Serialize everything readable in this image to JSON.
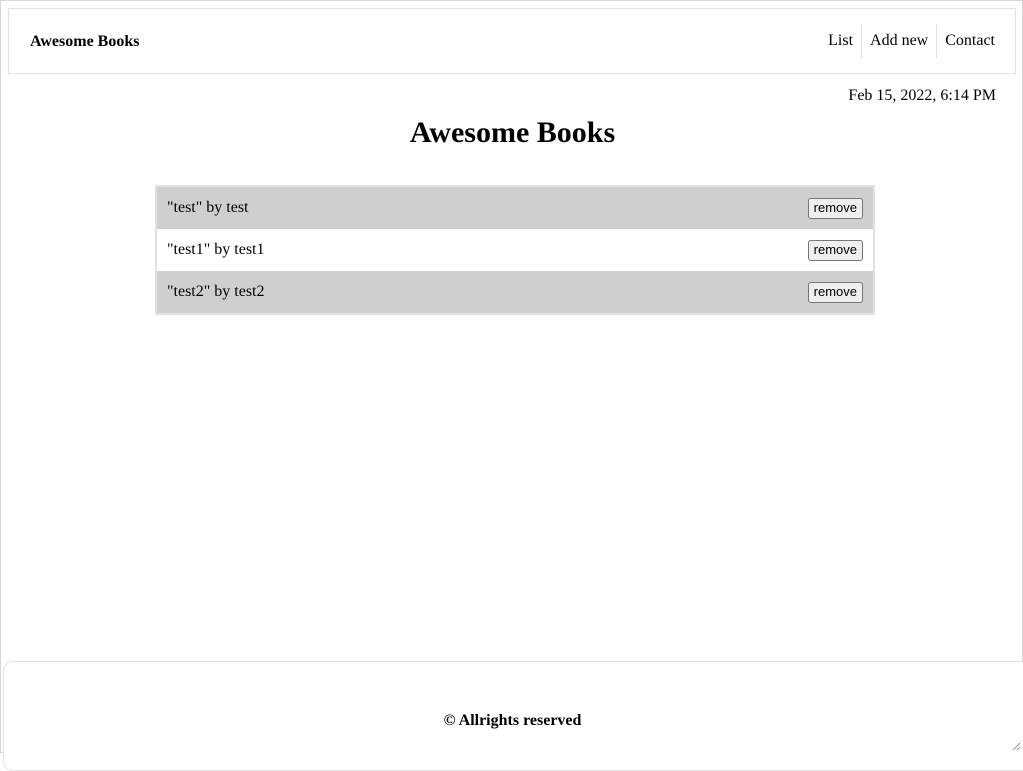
{
  "header": {
    "brand": "Awesome Books",
    "nav": [
      {
        "label": "List"
      },
      {
        "label": "Add new"
      },
      {
        "label": "Contact"
      }
    ]
  },
  "datetime": "Feb 15, 2022, 6:14 PM",
  "main": {
    "title": "Awesome Books",
    "books": [
      {
        "text": "\"test\" by test",
        "button_label": "remove"
      },
      {
        "text": "\"test1\" by test1",
        "button_label": "remove"
      },
      {
        "text": "\"test2\" by test2",
        "button_label": "remove"
      }
    ]
  },
  "footer": {
    "text": "© Allrights reserved"
  },
  "colors": {
    "row_highlight": "#d0cfcf",
    "border": "#e3e3e3",
    "button_bg": "#efefef"
  },
  "icons": {
    "resize_grip": "resize-grip-icon"
  }
}
